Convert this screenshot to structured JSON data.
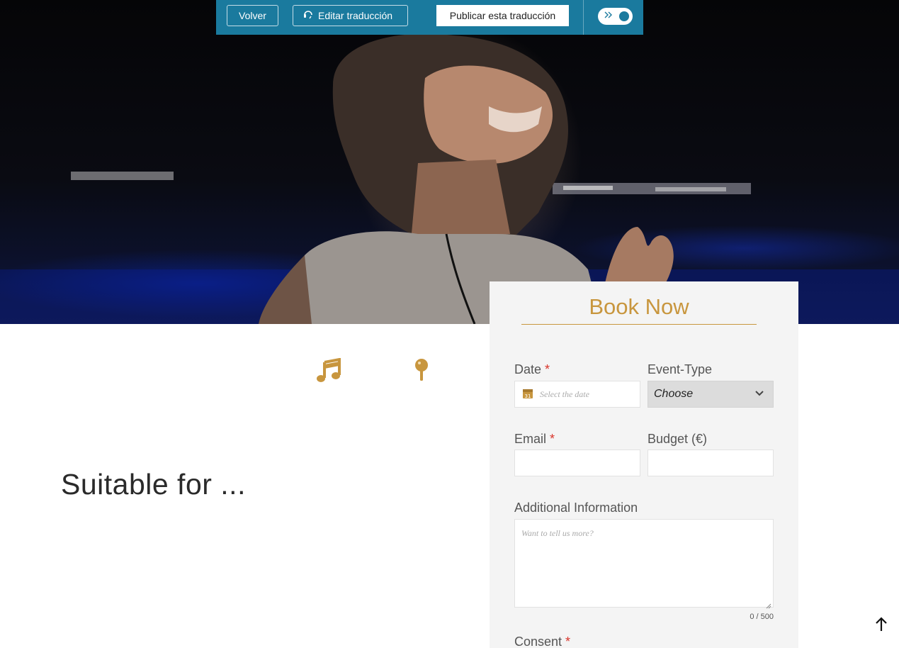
{
  "topbar": {
    "back_label": "Volver",
    "edit_label": "Editar traducción",
    "publish_label": "Publicar esta traducción",
    "edit_icon": "headset-icon",
    "toggle_icon": "double-chevron-icon"
  },
  "colors": {
    "topbar_bg": "#1a7a9e",
    "accent_gold": "#c8963e",
    "required_red": "#d9352b"
  },
  "features": {
    "icons": [
      "music-note-icon",
      "map-pin-icon"
    ]
  },
  "section": {
    "title": "Suitable for ..."
  },
  "booking": {
    "title": "Book Now",
    "date": {
      "label": "Date",
      "required": "*",
      "placeholder": "Select the date",
      "icon": "calendar-icon",
      "icon_text": "31"
    },
    "event_type": {
      "label": "Event-Type",
      "value": "Choose"
    },
    "email": {
      "label": "Email",
      "required": "*",
      "value": ""
    },
    "budget": {
      "label": "Budget (€)",
      "value": ""
    },
    "info": {
      "label": "Additional Information",
      "placeholder": "Want to tell us more?",
      "counter": "0 / 500"
    },
    "consent": {
      "label": "Consent",
      "required": "*"
    }
  }
}
